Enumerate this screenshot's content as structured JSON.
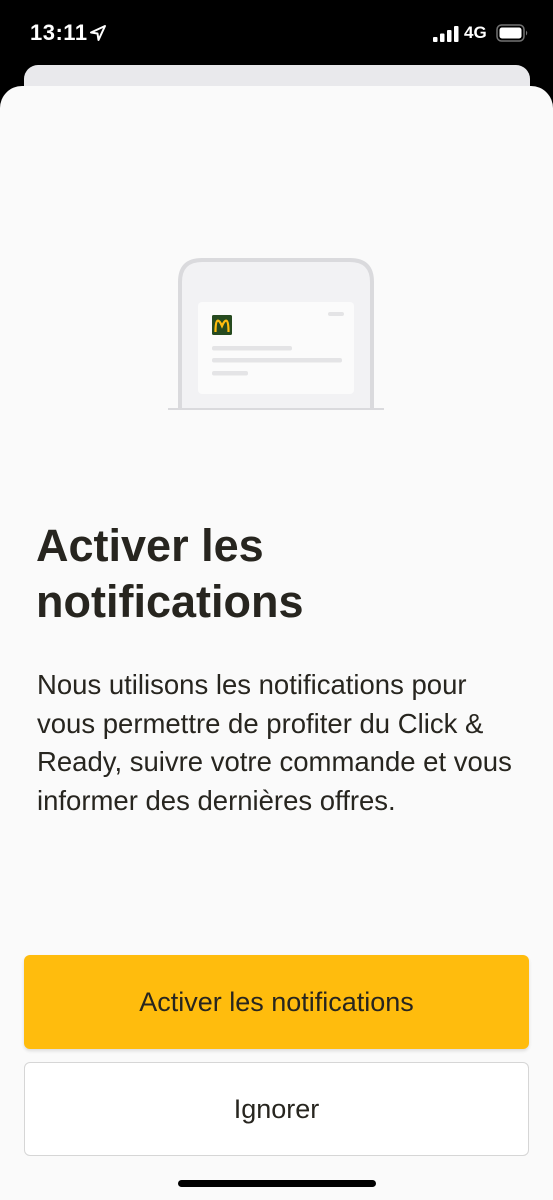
{
  "status_bar": {
    "time": "13:11",
    "network": "4G",
    "location_icon": "location-arrow-icon",
    "signal_icon": "cellular-signal-icon",
    "battery_icon": "battery-icon"
  },
  "illustration": {
    "icon": "phone-notification-illustration",
    "logo_icon": "mcdonalds-logo-icon",
    "logo_color": "#ffbc0d",
    "logo_background": "#264a1f"
  },
  "sheet": {
    "title": "Activer les notifications",
    "body": "Nous utilisons les notifications pour vous permettre de profiter du Click & Ready, suivre votre commande et vous informer des dernières offres."
  },
  "actions": {
    "primary_label": "Activer les notifications",
    "secondary_label": "Ignorer"
  },
  "colors": {
    "accent": "#ffbc0d",
    "text": "#27251f",
    "sheet_background": "#fafafa"
  }
}
